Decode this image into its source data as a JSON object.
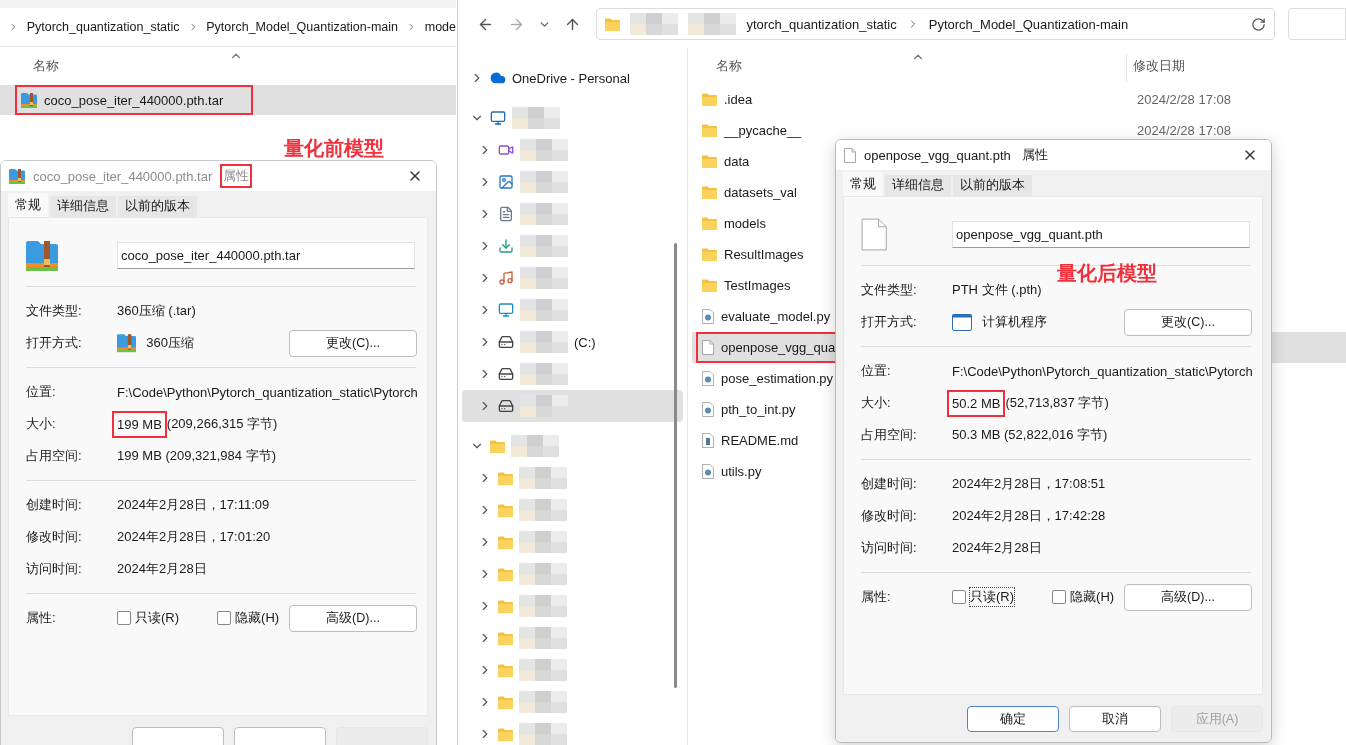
{
  "left_explorer": {
    "breadcrumb": [
      "Pytorch_quantization_static",
      "Pytorch_Model_Quantization-main",
      "mode"
    ],
    "columns": [
      "名称"
    ],
    "rows": [
      {
        "name": "coco_pose_iter_440000.pth.tar",
        "kind": "archive",
        "selected": true,
        "highlighted": true
      }
    ]
  },
  "main_explorer": {
    "address": [
      "ytorch_quantization_static",
      "Pytorch_Model_Quantization-main"
    ],
    "nav": [
      {
        "kind": "cloud",
        "label": "OneDrive - Personal",
        "expanded": false,
        "selected": false,
        "blurred": false
      },
      {
        "kind": "pc",
        "expanded": true,
        "selected": false,
        "blurred": true,
        "children": [
          {
            "kind": "video",
            "expanded": false,
            "selected": false,
            "blurred": true
          },
          {
            "kind": "image",
            "expanded": false,
            "selected": false,
            "blurred": true
          },
          {
            "kind": "doc",
            "expanded": false,
            "selected": false,
            "blurred": true
          },
          {
            "kind": "download",
            "expanded": false,
            "selected": false,
            "blurred": true
          },
          {
            "kind": "music",
            "expanded": false,
            "selected": false,
            "blurred": true
          },
          {
            "kind": "desktop",
            "expanded": false,
            "selected": false,
            "blurred": true
          },
          {
            "kind": "drive",
            "label": "(C:)",
            "expanded": false,
            "selected": false,
            "blurred": true
          },
          {
            "kind": "drive",
            "expanded": false,
            "selected": false,
            "blurred": true
          },
          {
            "kind": "drive",
            "expanded": false,
            "selected": true,
            "blurred": true
          }
        ]
      },
      {
        "kind": "folder",
        "expanded": true,
        "selected": false,
        "blurred": true,
        "children": [
          {
            "kind": "folder",
            "expanded": false,
            "selected": false,
            "blurred": true
          },
          {
            "kind": "folder",
            "expanded": false,
            "selected": false,
            "blurred": true
          },
          {
            "kind": "folder",
            "expanded": false,
            "selected": false,
            "blurred": true
          },
          {
            "kind": "folder",
            "expanded": false,
            "selected": false,
            "blurred": true
          },
          {
            "kind": "folder",
            "expanded": false,
            "selected": false,
            "blurred": true
          },
          {
            "kind": "folder",
            "expanded": false,
            "selected": false,
            "blurred": true
          },
          {
            "kind": "folder",
            "expanded": false,
            "selected": false,
            "blurred": true
          },
          {
            "kind": "folder",
            "expanded": false,
            "selected": false,
            "blurred": true
          },
          {
            "kind": "folder",
            "expanded": false,
            "selected": false,
            "blurred": true
          }
        ]
      }
    ],
    "columns": [
      "名称",
      "修改日期"
    ],
    "rows": [
      {
        "name": ".idea",
        "kind": "folder",
        "date": "2024/2/28 17:08",
        "selected": false,
        "highlighted": false
      },
      {
        "name": "__pycache__",
        "kind": "folder",
        "date": "2024/2/28 17:08",
        "selected": false,
        "highlighted": false
      },
      {
        "name": "data",
        "kind": "folder",
        "selected": false,
        "highlighted": false
      },
      {
        "name": "datasets_val",
        "kind": "folder",
        "selected": false,
        "highlighted": false
      },
      {
        "name": "models",
        "kind": "folder",
        "selected": false,
        "highlighted": false
      },
      {
        "name": "ResultImages",
        "kind": "folder",
        "selected": false,
        "highlighted": false
      },
      {
        "name": "TestImages",
        "kind": "folder",
        "selected": false,
        "highlighted": false
      },
      {
        "name": "evaluate_model.py",
        "kind": "py",
        "selected": false,
        "highlighted": false
      },
      {
        "name": "openpose_vgg_qua",
        "kind": "blank",
        "selected": true,
        "highlighted": true
      },
      {
        "name": "pose_estimation.py",
        "kind": "py",
        "selected": false,
        "highlighted": false
      },
      {
        "name": "pth_to_int.py",
        "kind": "py",
        "selected": false,
        "highlighted": false
      },
      {
        "name": "README.md",
        "kind": "md",
        "selected": false,
        "highlighted": false
      },
      {
        "name": "utils.py",
        "kind": "py",
        "selected": false,
        "highlighted": false
      }
    ]
  },
  "dialogs": [
    {
      "active": false,
      "kind": "archive",
      "title": "coco_pose_iter_440000.pth.tar",
      "title_suffix": "属性",
      "suffix_highlighted": true,
      "tabs": [
        {
          "label": "常规",
          "selected": true
        },
        {
          "label": "详细信息",
          "selected": false
        },
        {
          "label": "以前的版本",
          "selected": false
        }
      ],
      "file_name": "coco_pose_iter_440000.pth.tar",
      "sections": [
        [
          {
            "kind": "text",
            "label": "文件类型:",
            "value": "360压缩 (.tar)"
          },
          {
            "kind": "app",
            "label": "打开方式:",
            "value": "360压缩",
            "button": "更改(C)..."
          }
        ],
        [
          {
            "kind": "text",
            "label": "位置:",
            "value": "F:\\Code\\Python\\Pytorch_quantization_static\\Pytorch"
          },
          {
            "kind": "size",
            "label": "大小:",
            "value": "199 MB",
            "detail": "(209,266,315 字节)",
            "highlighted": true
          },
          {
            "kind": "text",
            "label": "占用空间:",
            "value": "199 MB (209,321,984 字节)"
          }
        ],
        [
          {
            "kind": "text",
            "label": "创建时间:",
            "value": "2024年2月28日，17:11:09"
          },
          {
            "kind": "text",
            "label": "修改时间:",
            "value": "2024年2月28日，17:01:20"
          },
          {
            "kind": "text",
            "label": "访问时间:",
            "value": "2024年2月28日"
          }
        ],
        [
          {
            "kind": "attributes",
            "label": "属性:",
            "checkboxes": [
              {
                "label": "只读(R)",
                "checked": false,
                "focused": false
              },
              {
                "label": "隐藏(H)",
                "checked": false,
                "focused": false
              }
            ],
            "button": "高级(D)..."
          }
        ]
      ],
      "footer": [
        {
          "disabled": false,
          "default": false
        },
        {
          "disabled": false,
          "default": false
        },
        {
          "disabled": true,
          "default": false
        }
      ]
    },
    {
      "active": true,
      "kind": "blank",
      "title": "openpose_vgg_quant.pth",
      "title_suffix": "属性",
      "suffix_highlighted": false,
      "tabs": [
        {
          "label": "常规",
          "selected": true
        },
        {
          "label": "详细信息",
          "selected": false
        },
        {
          "label": "以前的版本",
          "selected": false
        }
      ],
      "file_name": "openpose_vgg_quant.pth",
      "sections": [
        [
          {
            "kind": "text",
            "label": "文件类型:",
            "value": "PTH 文件 (.pth)"
          },
          {
            "kind": "app",
            "label": "打开方式:",
            "value": "计算机程序",
            "button": "更改(C)..."
          }
        ],
        [
          {
            "kind": "text",
            "label": "位置:",
            "value": "F:\\Code\\Python\\Pytorch_quantization_static\\Pytorch"
          },
          {
            "kind": "size",
            "label": "大小:",
            "value": "50.2 MB",
            "detail": "(52,713,837 字节)",
            "highlighted": true
          },
          {
            "kind": "text",
            "label": "占用空间:",
            "value": "50.3 MB (52,822,016 字节)"
          }
        ],
        [
          {
            "kind": "text",
            "label": "创建时间:",
            "value": "2024年2月28日，17:08:51"
          },
          {
            "kind": "text",
            "label": "修改时间:",
            "value": "2024年2月28日，17:42:28"
          },
          {
            "kind": "text",
            "label": "访问时间:",
            "value": "2024年2月28日"
          }
        ],
        [
          {
            "kind": "attributes",
            "label": "属性:",
            "checkboxes": [
              {
                "label": "只读(R)",
                "checked": false,
                "focused": true
              },
              {
                "label": "隐藏(H)",
                "checked": false,
                "focused": false
              }
            ],
            "button": "高级(D)..."
          }
        ]
      ],
      "footer": [
        {
          "label": "确定",
          "disabled": false,
          "default": true
        },
        {
          "label": "取消",
          "disabled": false,
          "default": false
        },
        {
          "label": "应用(A)",
          "disabled": true,
          "default": false
        }
      ]
    }
  ],
  "annotations": [
    "量化前模型",
    "量化后模型"
  ]
}
